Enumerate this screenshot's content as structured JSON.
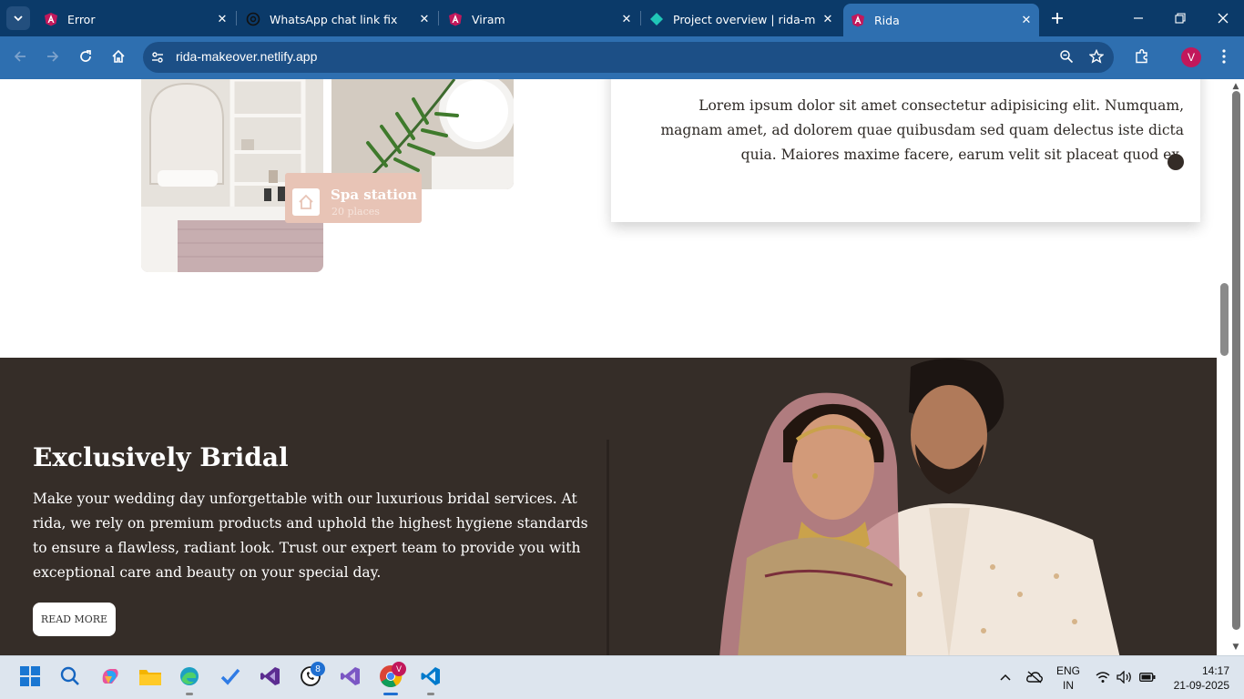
{
  "browser": {
    "tabs": [
      {
        "title": "Error",
        "icon": "angular-icon",
        "active": false
      },
      {
        "title": "WhatsApp chat link fix",
        "icon": "chatgpt-icon",
        "active": false
      },
      {
        "title": "Viram",
        "icon": "angular-icon",
        "active": false
      },
      {
        "title": "Project overview | rida-make",
        "icon": "netlify-icon",
        "active": false
      },
      {
        "title": "Rida",
        "icon": "angular-icon",
        "active": true
      }
    ],
    "url": "rida-makeover.netlify.app",
    "profile_initial": "V",
    "accent_color": "#2e6fb0"
  },
  "page": {
    "gallery": {
      "spa_badge_title": "Spa station",
      "spa_badge_subtitle": "20 places"
    },
    "card": {
      "text": "Lorem ipsum dolor sit amet consectetur adipisicing elit. Numquam, magnam amet, ad dolorem quae quibusdam sed quam delectus iste dicta quia. Maiores maxime facere, earum velit sit placeat quod ex."
    },
    "bridal": {
      "title": "Exclusively Bridal",
      "text": "Make your wedding day unforgettable with our luxurious bridal services. At rida, we rely on premium products and uphold the highest hygiene standards to ensure a flawless, radiant look. Trust our expert team to provide you with exceptional care and beauty on your special day.",
      "button": "READ MORE",
      "bg_color": "#352d28"
    }
  },
  "taskbar": {
    "whatsapp_badge": "8",
    "chrome_badge": "V",
    "lang_line1": "ENG",
    "lang_line2": "IN",
    "time": "14:17",
    "date": "21-09-2025"
  }
}
